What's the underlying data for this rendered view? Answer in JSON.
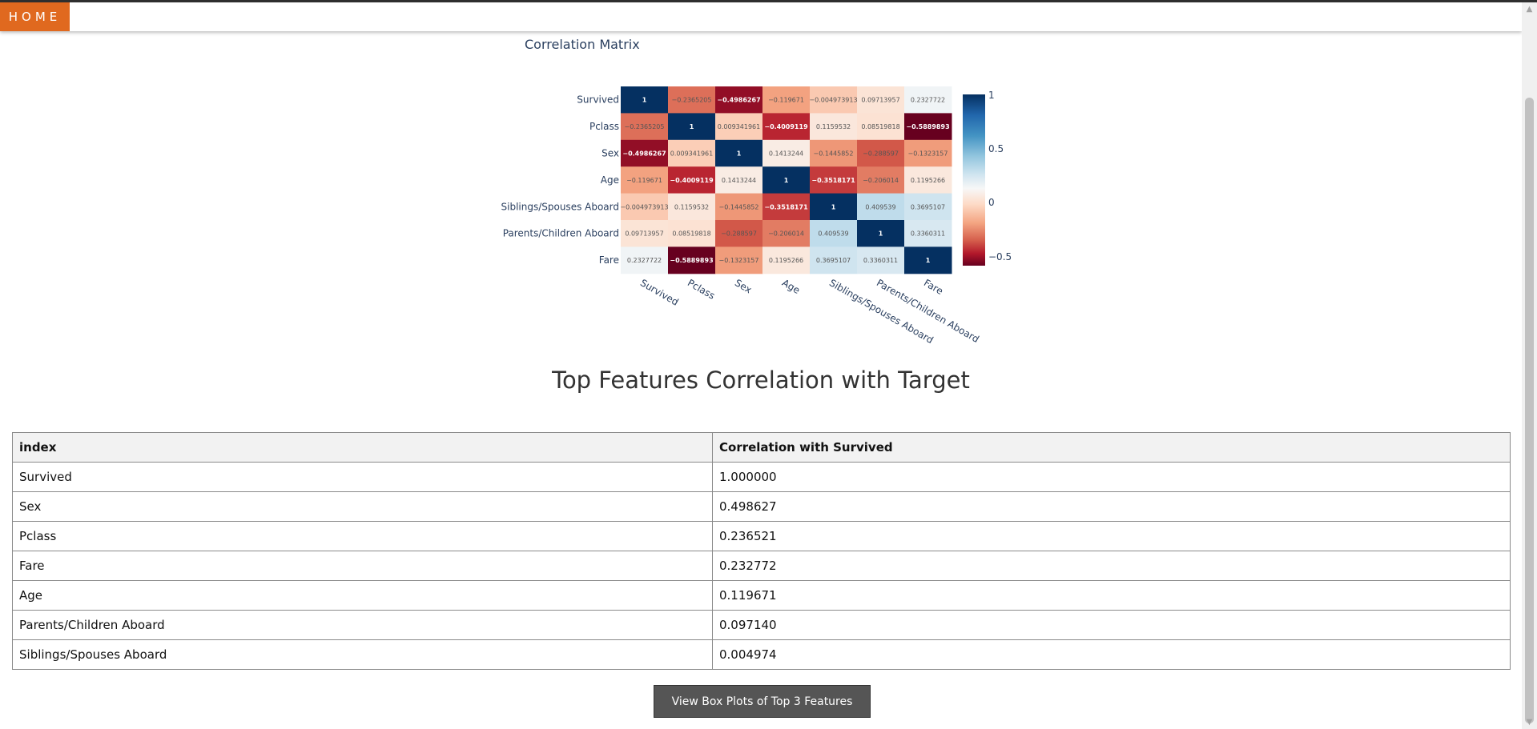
{
  "nav": {
    "home_label": "HOME"
  },
  "heatmap": {
    "title": "Correlation Matrix",
    "colorbar_ticks": [
      "1",
      "0.5",
      "0",
      "−0.5"
    ]
  },
  "chart_data": {
    "type": "heatmap",
    "title": "Correlation Matrix",
    "x": [
      "Survived",
      "Pclass",
      "Sex",
      "Age",
      "Siblings/Spouses Aboard",
      "Parents/Children Aboard",
      "Fare"
    ],
    "y": [
      "Survived",
      "Pclass",
      "Sex",
      "Age",
      "Siblings/Spouses Aboard",
      "Parents/Children Aboard",
      "Fare"
    ],
    "z": [
      [
        1,
        -0.2365205,
        -0.4986267,
        -0.119671,
        -0.004973913,
        0.09713957,
        0.2327722
      ],
      [
        -0.2365205,
        1,
        0.009341961,
        -0.4009119,
        0.1159532,
        0.08519818,
        -0.5889893
      ],
      [
        -0.4986267,
        0.009341961,
        1,
        0.1413244,
        -0.1445852,
        -0.288597,
        -0.1323157
      ],
      [
        -0.119671,
        -0.4009119,
        0.1413244,
        1,
        -0.3518171,
        -0.206014,
        0.1195266
      ],
      [
        -0.004973913,
        0.1159532,
        -0.1445852,
        -0.3518171,
        1,
        0.409539,
        0.3695107
      ],
      [
        0.09713957,
        0.08519818,
        -0.288597,
        -0.206014,
        0.409539,
        1,
        0.3360311
      ],
      [
        0.2327722,
        -0.5889893,
        -0.1323157,
        0.1195266,
        0.3695107,
        0.3360311,
        1
      ]
    ],
    "colorscale": "RdBu",
    "zmin": -0.5889893,
    "zmax": 1
  },
  "section": {
    "title": "Top Features Correlation with Target"
  },
  "table": {
    "headers": [
      "index",
      "Correlation with Survived"
    ],
    "rows": [
      [
        "Survived",
        "1.000000"
      ],
      [
        "Sex",
        "0.498627"
      ],
      [
        "Pclass",
        "0.236521"
      ],
      [
        "Fare",
        "0.232772"
      ],
      [
        "Age",
        "0.119671"
      ],
      [
        "Parents/Children Aboard",
        "0.097140"
      ],
      [
        "Siblings/Spouses Aboard",
        "0.004974"
      ]
    ]
  },
  "button": {
    "label": "View Box Plots of Top 3 Features"
  }
}
